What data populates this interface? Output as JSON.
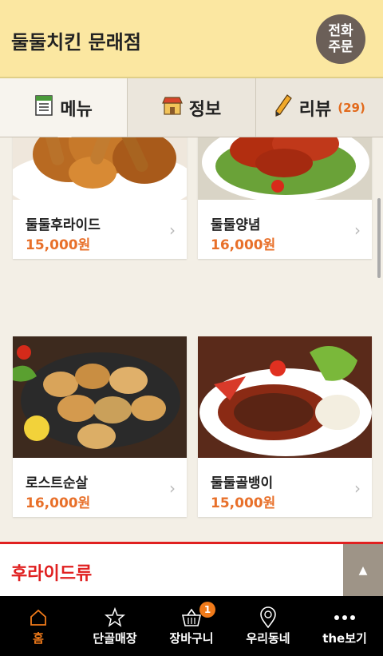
{
  "header": {
    "title": "둘둘치킨 문래점",
    "call_line1": "전화",
    "call_line2": "주문"
  },
  "tabs": [
    {
      "label": "메뉴",
      "icon": "menu-sheet-icon"
    },
    {
      "label": "정보",
      "icon": "store-icon"
    },
    {
      "label": "리뷰",
      "count": "(29)",
      "icon": "pencil-icon"
    }
  ],
  "menu_items": [
    {
      "name": "둘둘후라이드",
      "price": "15,000원",
      "image": "fried-chicken-image"
    },
    {
      "name": "둘둘양념",
      "price": "16,000원",
      "image": "seasoned-chicken-image"
    },
    {
      "name": "로스트순살",
      "price": "16,000원",
      "image": "roast-boneless-chicken-image"
    },
    {
      "name": "둘둘골뱅이",
      "price": "15,000원",
      "image": "whelk-salad-image"
    }
  ],
  "category": {
    "title": "후라이드류"
  },
  "nav": [
    {
      "label": "홈",
      "icon": "home-icon"
    },
    {
      "label": "단골매장",
      "icon": "star-icon"
    },
    {
      "label": "장바구니",
      "icon": "basket-icon",
      "badge": "1"
    },
    {
      "label": "우리동네",
      "icon": "map-pin-icon"
    },
    {
      "label": "the보기",
      "icon": "more-icon"
    }
  ],
  "colors": {
    "accent": "#f07a1a",
    "header_bg": "#fbe7a1",
    "category_red": "#e02020",
    "price": "#e8702a"
  }
}
